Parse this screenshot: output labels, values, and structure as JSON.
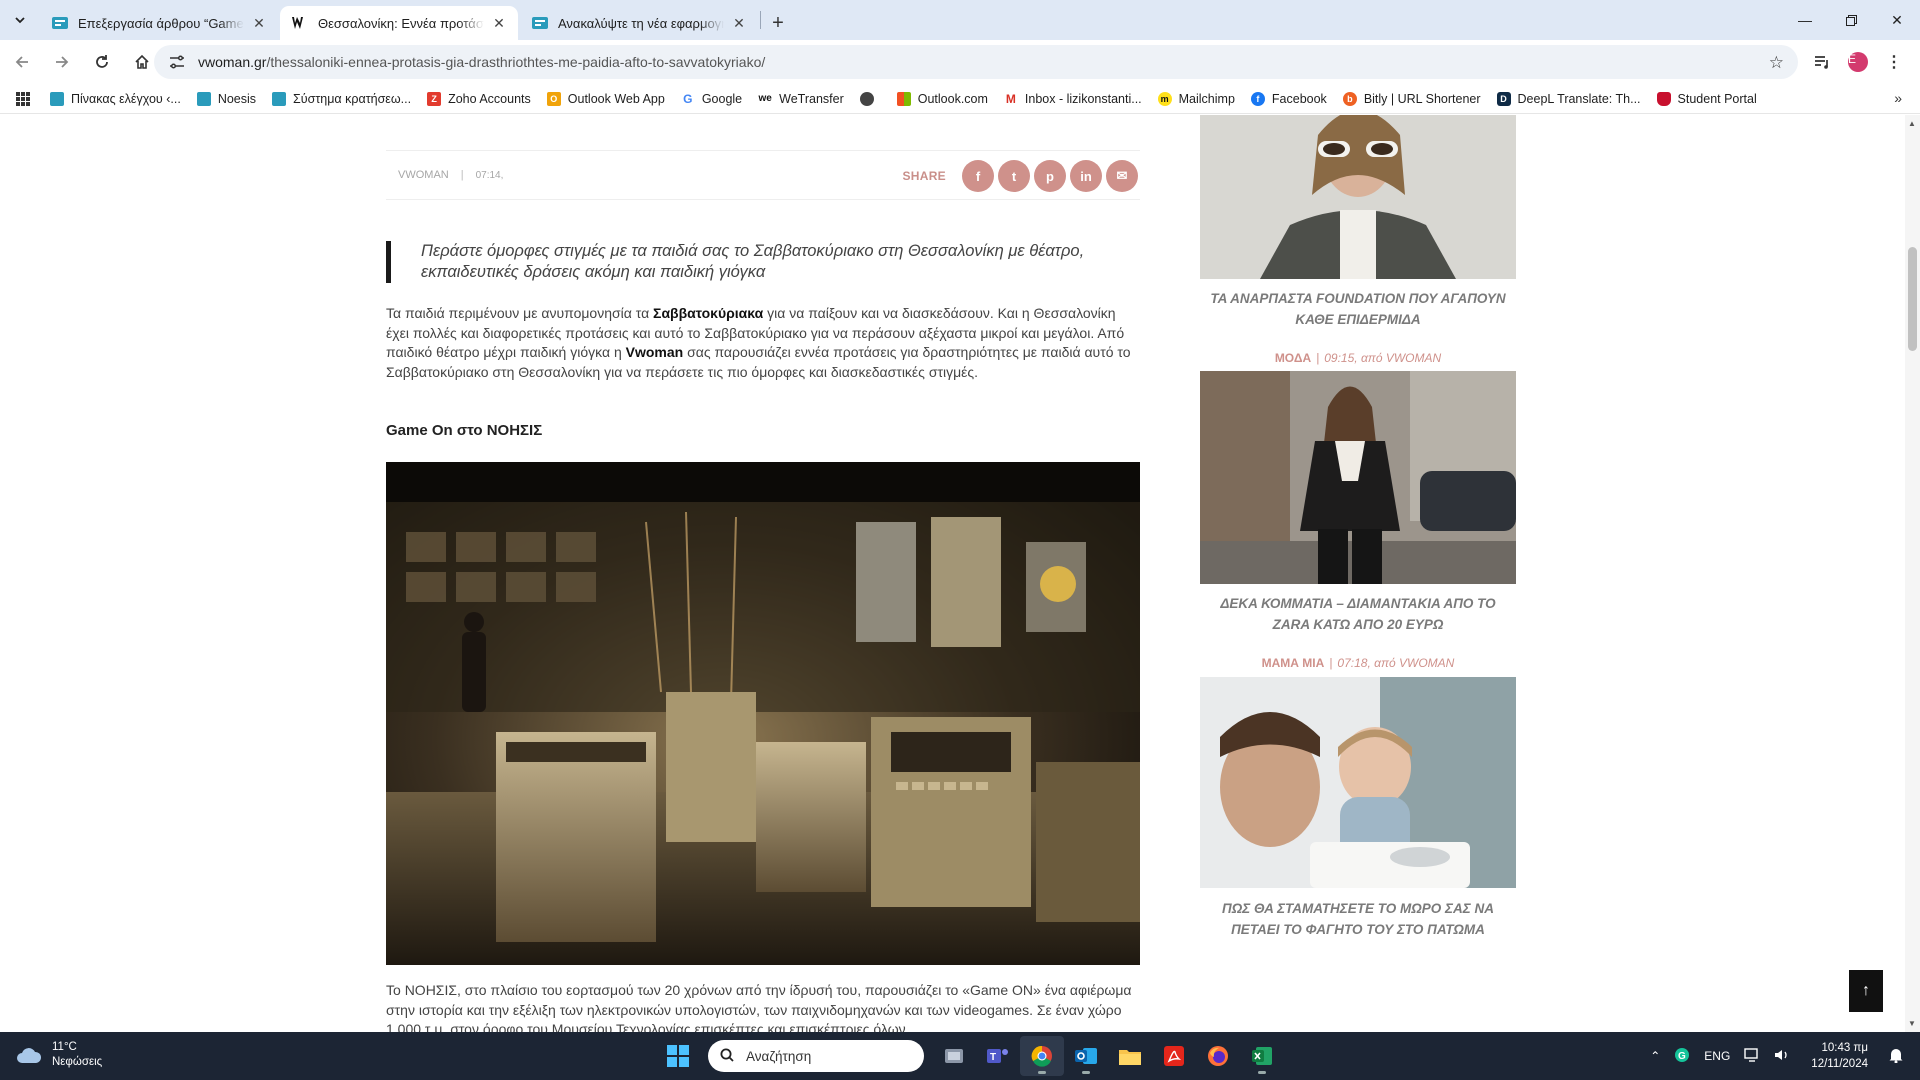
{
  "browser": {
    "tabs": [
      {
        "title": "Επεξεργασία άρθρου “Game ON”",
        "active": false
      },
      {
        "title": "Θεσσαλονίκη: Εννέα προτάσεις",
        "active": true
      },
      {
        "title": "Ανακαλύψτε τη νέα εφαρμογή",
        "active": false
      }
    ],
    "url_host": "vwoman.gr",
    "url_path": "/thessaloniki-ennea-protasis-gia-drasthriothtes-me-paidia-afto-to-savvatokyriako/",
    "profile_initial": "E",
    "bookmarks": [
      {
        "label": "Πίνακας ελέγχου ‹...",
        "color": "#2a9bbb"
      },
      {
        "label": "Noesis",
        "color": "#2a9bbb"
      },
      {
        "label": "Σύστημα κρατήσεω...",
        "color": "#2a9bbb"
      },
      {
        "label": "Zoho Accounts",
        "color": "#e23b2e"
      },
      {
        "label": "Outlook Web App",
        "color": "#f0a30a"
      },
      {
        "label": "Google",
        "color": "#4285f4"
      },
      {
        "label": "WeTransfer",
        "color": "#111111"
      },
      {
        "label": "",
        "color": "#444444"
      },
      {
        "label": "Outlook.com",
        "color": "#f25022"
      },
      {
        "label": "Inbox - lizikonstanti...",
        "color": "#d93025"
      },
      {
        "label": "Mailchimp",
        "color": "#ffe01b"
      },
      {
        "label": "Facebook",
        "color": "#1877f2"
      },
      {
        "label": "Bitly | URL Shortener",
        "color": "#ee6123"
      },
      {
        "label": "DeepL Translate: Th...",
        "color": "#0f2b46"
      },
      {
        "label": "Student Portal",
        "color": "#c8102e"
      }
    ]
  },
  "article": {
    "author": "VWOMAN",
    "time": "07:14,",
    "share_label": "SHARE",
    "share_icons": [
      "f",
      "t",
      "p",
      "in",
      "✉"
    ],
    "lead": "Περάστε όμορφες στιγμές με τα παιδιά σας το Σαββατοκύριακο στη Θεσσαλονίκη με θέατρο, εκπαιδευτικές δράσεις ακόμη και παιδική γιόγκα",
    "p1_a": "Τα παιδιά περιμένουν με ανυπομονησία τα ",
    "p1_b": "Σαββατοκύριακα",
    "p1_c": " για να παίξουν και να διασκεδάσουν. Και η Θεσσαλονίκη έχει πολλές και διαφορετικές προτάσεις και αυτό το Σαββατοκύριακο για να περάσουν αξέχαστα μικροί και μεγάλοι. Από παιδικό θέατρο μέχρι παιδική γιόγκα η ",
    "p1_d": "Vwoman",
    "p1_e": " σας παρουσιάζει εννέα προτάσεις για δραστηριότητες με παιδιά αυτό το Σαββατοκύριακο στη Θεσσαλονίκη για να περάσετε τις πιο όμορφες και διασκεδαστικές στιγμές.",
    "heading": "Game On στο ΝΟΗΣΙΣ",
    "p2": "Το ΝΟΗΣΙΣ, στο πλαίσιο του εορτασμού των 20 χρόνων από την ίδρυσή του, παρουσιάζει το «Game ON» ένα αφιέρωμα στην ιστορία και την εξέλιξη των ηλεκτρονικών υπολογιστών, των παιχνιδομηχανών και των videogames. Σε έναν χώρο 1.000 τ.μ. στον όροφο του Μουσείου Τεχνολογίας επισκέπτες και επισκέπτριες όλων"
  },
  "sidebar": [
    {
      "title": "ΤΑ ΑΝΑΡΠΑΣΤΑ FOUNDATION ΠΟΥ ΑΓΑΠΟΥΝ ΚΑΘΕ ΕΠΙΔΕΡΜΙΔΑ",
      "category": "ΜΟΔΑ",
      "meta": "09:15, από VWOMAN"
    },
    {
      "title": "ΔΕΚΑ ΚΟΜΜΑΤΙΑ – ΔΙΑΜΑΝΤΑΚΙΑ ΑΠΟ ΤΟ ZARA ΚΑΤΩ ΑΠΟ 20 ΕΥΡΩ",
      "category": "ΜΑΜΑ ΜΙΑ",
      "meta": "07:18, από VWOMAN"
    },
    {
      "title": "ΠΩΣ ΘΑ ΣΤΑΜΑΤΗΣΕΤΕ ΤΟ ΜΩΡΟ ΣΑΣ ΝΑ ΠΕΤΑΕΙ ΤΟ ΦΑΓΗΤΟ ΤΟΥ ΣΤΟ ΠΑΤΩΜΑ"
    }
  ],
  "taskbar": {
    "temperature": "11°C",
    "weather": "Νεφώσεις",
    "search_placeholder": "Αναζήτηση",
    "lang": "ENG",
    "time": "10:43 πμ",
    "date": "12/11/2024"
  }
}
